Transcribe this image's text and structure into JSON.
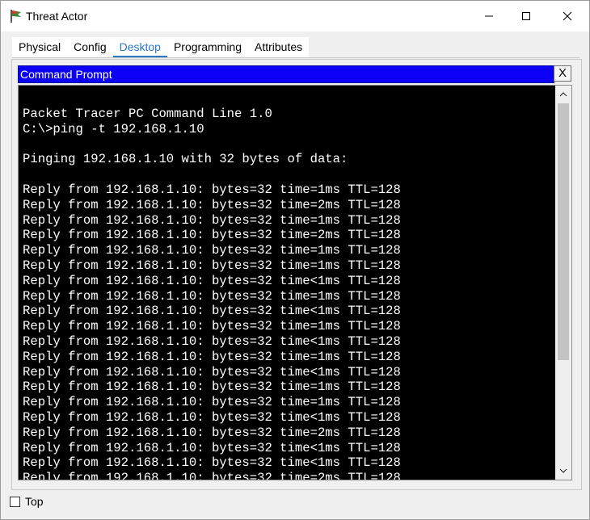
{
  "window": {
    "title": "Threat Actor",
    "controls": {
      "minimize": "minimize-icon",
      "maximize": "maximize-icon",
      "close": "close-icon"
    }
  },
  "tabs": [
    {
      "label": "Physical",
      "active": false
    },
    {
      "label": "Config",
      "active": false
    },
    {
      "label": "Desktop",
      "active": true
    },
    {
      "label": "Programming",
      "active": false
    },
    {
      "label": "Attributes",
      "active": false
    }
  ],
  "command_prompt": {
    "title": "Command Prompt",
    "close_label": "X",
    "lines": [
      "Packet Tracer PC Command Line 1.0",
      "C:\\>ping -t 192.168.1.10",
      "",
      "Pinging 192.168.1.10 with 32 bytes of data:",
      "",
      "Reply from 192.168.1.10: bytes=32 time=1ms TTL=128",
      "Reply from 192.168.1.10: bytes=32 time=2ms TTL=128",
      "Reply from 192.168.1.10: bytes=32 time=1ms TTL=128",
      "Reply from 192.168.1.10: bytes=32 time=2ms TTL=128",
      "Reply from 192.168.1.10: bytes=32 time=1ms TTL=128",
      "Reply from 192.168.1.10: bytes=32 time=1ms TTL=128",
      "Reply from 192.168.1.10: bytes=32 time<1ms TTL=128",
      "Reply from 192.168.1.10: bytes=32 time=1ms TTL=128",
      "Reply from 192.168.1.10: bytes=32 time<1ms TTL=128",
      "Reply from 192.168.1.10: bytes=32 time=1ms TTL=128",
      "Reply from 192.168.1.10: bytes=32 time<1ms TTL=128",
      "Reply from 192.168.1.10: bytes=32 time=1ms TTL=128",
      "Reply from 192.168.1.10: bytes=32 time<1ms TTL=128",
      "Reply from 192.168.1.10: bytes=32 time=1ms TTL=128",
      "Reply from 192.168.1.10: bytes=32 time=1ms TTL=128",
      "Reply from 192.168.1.10: bytes=32 time<1ms TTL=128",
      "Reply from 192.168.1.10: bytes=32 time=2ms TTL=128",
      "Reply from 192.168.1.10: bytes=32 time<1ms TTL=128",
      "Reply from 192.168.1.10: bytes=32 time<1ms TTL=128",
      "Reply from 192.168.1.10: bytes=32 time=2ms TTL=128"
    ],
    "scroll_position": 0.0
  },
  "footer": {
    "top_label": "Top",
    "top_checked": false
  },
  "colors": {
    "cmd_header_bg": "#0b00f5",
    "terminal_bg": "#000000",
    "terminal_fg": "#ffffff",
    "active_tab": "#2a78c8"
  }
}
